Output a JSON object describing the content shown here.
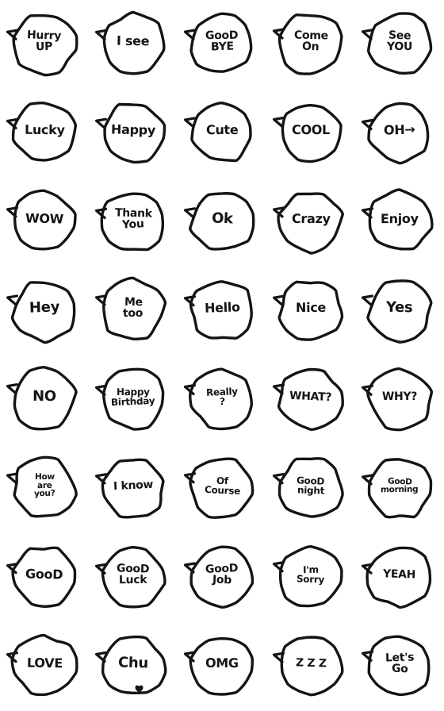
{
  "sheet": {
    "title": "Handwritten Speech Bubble Emoji Sheet",
    "columns": 5,
    "rows": 8,
    "total": 40,
    "background_color": "#ffffff",
    "ink_color": "#141414",
    "style": "hand-drawn black line speech bubble with tail on left"
  },
  "stickers": [
    {
      "id": 1,
      "name": "hurry-up",
      "lines": [
        "Hurry",
        "UP"
      ],
      "size": "md"
    },
    {
      "id": 2,
      "name": "i-see",
      "lines": [
        "I see"
      ],
      "size": "lg"
    },
    {
      "id": 3,
      "name": "good-bye",
      "lines": [
        "GooD",
        "BYE"
      ],
      "size": "md"
    },
    {
      "id": 4,
      "name": "come-on",
      "lines": [
        "Come",
        "On"
      ],
      "size": "md"
    },
    {
      "id": 5,
      "name": "see-you",
      "lines": [
        "See",
        "YOU"
      ],
      "size": "md"
    },
    {
      "id": 6,
      "name": "lucky",
      "lines": [
        "Lucky"
      ],
      "size": "lg"
    },
    {
      "id": 7,
      "name": "happy",
      "lines": [
        "Happy"
      ],
      "size": "lg"
    },
    {
      "id": 8,
      "name": "cute",
      "lines": [
        "Cute"
      ],
      "size": "lg"
    },
    {
      "id": 9,
      "name": "cool",
      "lines": [
        "COOL"
      ],
      "size": "lg"
    },
    {
      "id": 10,
      "name": "oh-arrow",
      "lines": [
        "OH→"
      ],
      "size": "lg"
    },
    {
      "id": 11,
      "name": "wow",
      "lines": [
        "WOW"
      ],
      "size": "lg"
    },
    {
      "id": 12,
      "name": "thank-you",
      "lines": [
        "Thank",
        "You"
      ],
      "size": "md"
    },
    {
      "id": 13,
      "name": "ok",
      "lines": [
        "Ok"
      ],
      "size": "xl"
    },
    {
      "id": 14,
      "name": "crazy",
      "lines": [
        "Crazy"
      ],
      "size": "lg"
    },
    {
      "id": 15,
      "name": "enjoy",
      "lines": [
        "Enjoy"
      ],
      "size": "lg"
    },
    {
      "id": 16,
      "name": "hey",
      "lines": [
        "Hey"
      ],
      "size": "xl"
    },
    {
      "id": 17,
      "name": "me-too",
      "lines": [
        "Me",
        "too"
      ],
      "size": "md"
    },
    {
      "id": 18,
      "name": "hello",
      "lines": [
        "Hello"
      ],
      "size": "lg"
    },
    {
      "id": 19,
      "name": "nice",
      "lines": [
        "Nice"
      ],
      "size": "lg"
    },
    {
      "id": 20,
      "name": "yes",
      "lines": [
        "Yes"
      ],
      "size": "xl"
    },
    {
      "id": 21,
      "name": "no",
      "lines": [
        "NO"
      ],
      "size": "xl"
    },
    {
      "id": 22,
      "name": "happy-birthday",
      "lines": [
        "Happy",
        "Birthday"
      ],
      "size": "sm"
    },
    {
      "id": 23,
      "name": "really",
      "lines": [
        "Really",
        "?"
      ],
      "size": "sm"
    },
    {
      "id": 24,
      "name": "what",
      "lines": [
        "WHAT?"
      ],
      "size": "md"
    },
    {
      "id": 25,
      "name": "why",
      "lines": [
        "WHY?"
      ],
      "size": "md"
    },
    {
      "id": 26,
      "name": "how-are-you",
      "lines": [
        "How",
        "are",
        "you?"
      ],
      "size": "xs"
    },
    {
      "id": 27,
      "name": "i-know",
      "lines": [
        "I know"
      ],
      "size": "md"
    },
    {
      "id": 28,
      "name": "of-course",
      "lines": [
        "Of",
        "Course"
      ],
      "size": "sm"
    },
    {
      "id": 29,
      "name": "good-night",
      "lines": [
        "GooD",
        "night"
      ],
      "size": "sm"
    },
    {
      "id": 30,
      "name": "good-morning",
      "lines": [
        "GooD",
        "morning"
      ],
      "size": "xs"
    },
    {
      "id": 31,
      "name": "good",
      "lines": [
        "GooD"
      ],
      "size": "lg"
    },
    {
      "id": 32,
      "name": "good-luck",
      "lines": [
        "GooD",
        "Luck"
      ],
      "size": "md"
    },
    {
      "id": 33,
      "name": "good-job",
      "lines": [
        "GooD",
        "Job"
      ],
      "size": "md"
    },
    {
      "id": 34,
      "name": "im-sorry",
      "lines": [
        "I'm",
        "Sorry"
      ],
      "size": "sm"
    },
    {
      "id": 35,
      "name": "yeah",
      "lines": [
        "YEAH"
      ],
      "size": "md"
    },
    {
      "id": 36,
      "name": "love",
      "lines": [
        "LOVE"
      ],
      "size": "lg"
    },
    {
      "id": 37,
      "name": "chu",
      "lines": [
        "Chu"
      ],
      "size": "xl",
      "mark": "kiss-mark"
    },
    {
      "id": 38,
      "name": "omg",
      "lines": [
        "OMG"
      ],
      "size": "lg"
    },
    {
      "id": 39,
      "name": "zzz",
      "lines": [
        "Z Z Z"
      ],
      "size": "md"
    },
    {
      "id": 40,
      "name": "lets-go",
      "lines": [
        "Let's",
        "Go"
      ],
      "size": "md"
    }
  ]
}
